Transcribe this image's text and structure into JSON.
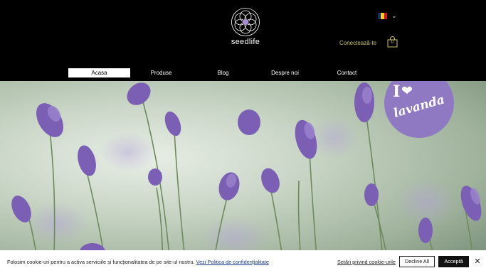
{
  "header": {
    "logo_text": "seedlife",
    "login_label": "Conectează-te",
    "cart_count": "0",
    "language_flag_colors": [
      "#002b7f",
      "#fcd116",
      "#ce1126"
    ],
    "accent_color": "#c9c36a"
  },
  "nav": {
    "items": [
      {
        "label": "Acasa",
        "active": true
      },
      {
        "label": "Produse",
        "active": false
      },
      {
        "label": "Blog",
        "active": false
      },
      {
        "label": "Despre noi",
        "active": false
      },
      {
        "label": "Contact",
        "active": false
      }
    ]
  },
  "hero": {
    "badge_i": "I",
    "badge_text": "lavanda",
    "badge_color": "#8e79c2",
    "icons": [
      "heart-icon"
    ]
  },
  "cookie_bar": {
    "text": "Folosim cookie-uri pentru a activa serviciile și funcționalitatea de pe site-ul nostru.",
    "policy_link": "Vezi Politica de confidențialitate",
    "settings_link": "Setări privind cookie-urile",
    "decline_label": "Decline All",
    "accept_label": "Acceptă"
  }
}
